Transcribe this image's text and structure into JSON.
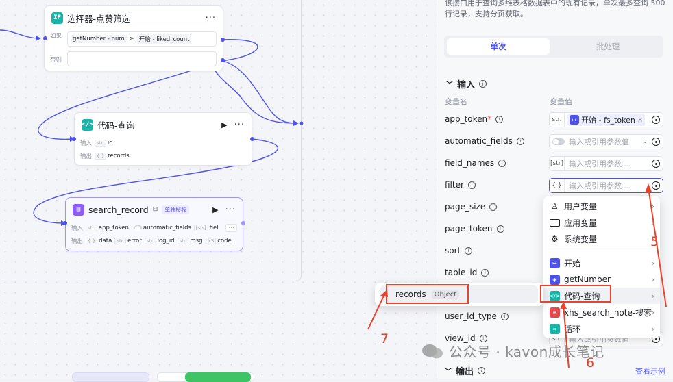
{
  "canvas": {
    "selector_node": {
      "title": "选择器-点赞筛选",
      "if_label": "如果",
      "left_operand": "getNumber - num",
      "operator": "≥",
      "right_operand": "开始 - liked_count",
      "else_label": "否则"
    },
    "code_node": {
      "title": "代码-查询",
      "input_label": "输入",
      "input_type": "str.",
      "input_name": "id",
      "output_label": "输出",
      "output_type": "{ }",
      "output_name": "records"
    },
    "search_node": {
      "title": "search_record",
      "badge": "单独授权",
      "input_label": "输入",
      "inputs": [
        {
          "type": "str.",
          "name": "app_token"
        },
        {
          "type": "toggle",
          "name": "automatic_fields"
        },
        {
          "type": "[str]",
          "name": "fiel"
        }
      ],
      "output_label": "输出",
      "outputs": [
        {
          "type": "{ }",
          "name": "data"
        },
        {
          "type": "str.",
          "name": "error"
        },
        {
          "type": "str.",
          "name": "log_id"
        },
        {
          "type": "str.",
          "name": "msg"
        },
        {
          "type": "NS",
          "name": "code"
        }
      ]
    }
  },
  "panel": {
    "description": "该接口用于查询多维表格数据表中的现有记录，单次最多查询 500 行记录，支持分页获取。",
    "tabs": {
      "single": "单次",
      "batch": "批处理"
    },
    "input_section": "输入",
    "col_name": "变量名",
    "col_value": "变量值",
    "params": [
      {
        "name": "app_token",
        "required": true,
        "type": "str.",
        "value_tag": "开始 - fs_token"
      },
      {
        "name": "automatic_fields",
        "type": "toggle",
        "placeholder": "输入或引用参数值"
      },
      {
        "name": "field_names",
        "type": "[str]",
        "placeholder": "输入或引用参数..."
      },
      {
        "name": "filter",
        "type": "{ }",
        "placeholder": "输入或引用参数..."
      },
      {
        "name": "page_size"
      },
      {
        "name": "page_token"
      },
      {
        "name": "sort"
      },
      {
        "name": "table_id"
      },
      {
        "name": "user_id_type"
      },
      {
        "name": "view_id",
        "type": "str.",
        "placeholder": "输入或引用参数值"
      }
    ],
    "output_section": "输出",
    "example_link": "查看示例"
  },
  "menu": {
    "items": [
      {
        "label": "用户变量",
        "icon": "user-icon"
      },
      {
        "label": "应用变量",
        "icon": "folder-icon"
      },
      {
        "label": "系统变量",
        "icon": "gear-icon"
      },
      {
        "label": "开始",
        "icon": "start-icon",
        "color": "#4d53e8"
      },
      {
        "label": "getNumber",
        "icon": "cube-icon",
        "color": "#4d53e8"
      },
      {
        "label": "代码-查询",
        "icon": "code-icon",
        "color": "#1bb3a7"
      },
      {
        "label": "xhs_search_note-搜索",
        "icon": "plugin-icon",
        "color": "#e5484d"
      },
      {
        "label": "循环",
        "icon": "loop-icon",
        "color": "#1bb3a7"
      }
    ]
  },
  "submenu": {
    "label": "records",
    "type": "Object"
  },
  "annotations": {
    "n5": "5",
    "n6": "6",
    "n7": "7"
  },
  "watermark": "公众号 · kavon成长笔记",
  "colors": {
    "accent": "#4d53e8",
    "teal": "#1bb3a7",
    "annotation": "#e8432c"
  }
}
